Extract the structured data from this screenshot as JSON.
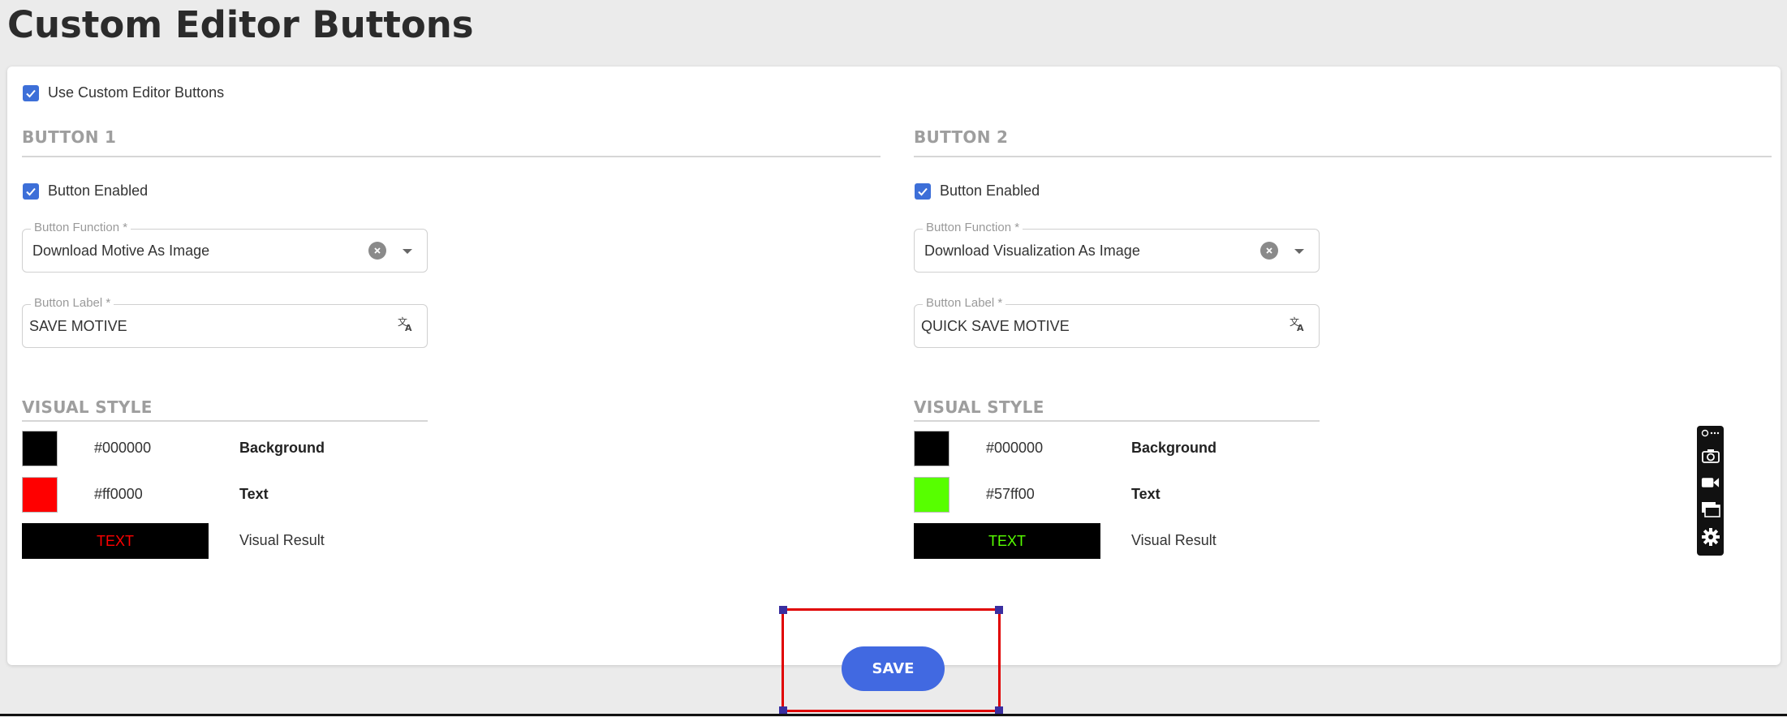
{
  "page": {
    "title": "Custom Editor Buttons"
  },
  "use_custom": {
    "label": "Use Custom Editor Buttons",
    "checked": true
  },
  "buttons": [
    {
      "heading": "BUTTON 1",
      "enabled_label": "Button Enabled",
      "enabled": true,
      "function_label": "Button Function *",
      "function_value": "Download Motive As Image",
      "label_label": "Button Label *",
      "label_value": "SAVE MOTIVE",
      "visual_heading": "VISUAL STYLE",
      "background_hex": "#000000",
      "background_name": "Background",
      "text_hex": "#ff0000",
      "text_name": "Text",
      "preview_text": "TEXT",
      "preview_caption": "Visual Result"
    },
    {
      "heading": "BUTTON 2",
      "enabled_label": "Button Enabled",
      "enabled": true,
      "function_label": "Button Function *",
      "function_value": "Download Visualization As Image",
      "label_label": "Button Label *",
      "label_value": "QUICK SAVE MOTIVE",
      "visual_heading": "VISUAL STYLE",
      "background_hex": "#000000",
      "background_name": "Background",
      "text_hex": "#57ff00",
      "text_name": "Text",
      "preview_text": "TEXT",
      "preview_caption": "Visual Result"
    }
  ],
  "save": {
    "label": "SAVE"
  },
  "toolbar": {
    "icons": [
      "screen-capture-menu-icon",
      "camera-icon",
      "video-camera-icon",
      "windows-icon",
      "gear-icon"
    ]
  },
  "colors": {
    "accent": "#4169e1",
    "checkbox": "#3d6fd8",
    "highlight_frame": "#e00000"
  }
}
